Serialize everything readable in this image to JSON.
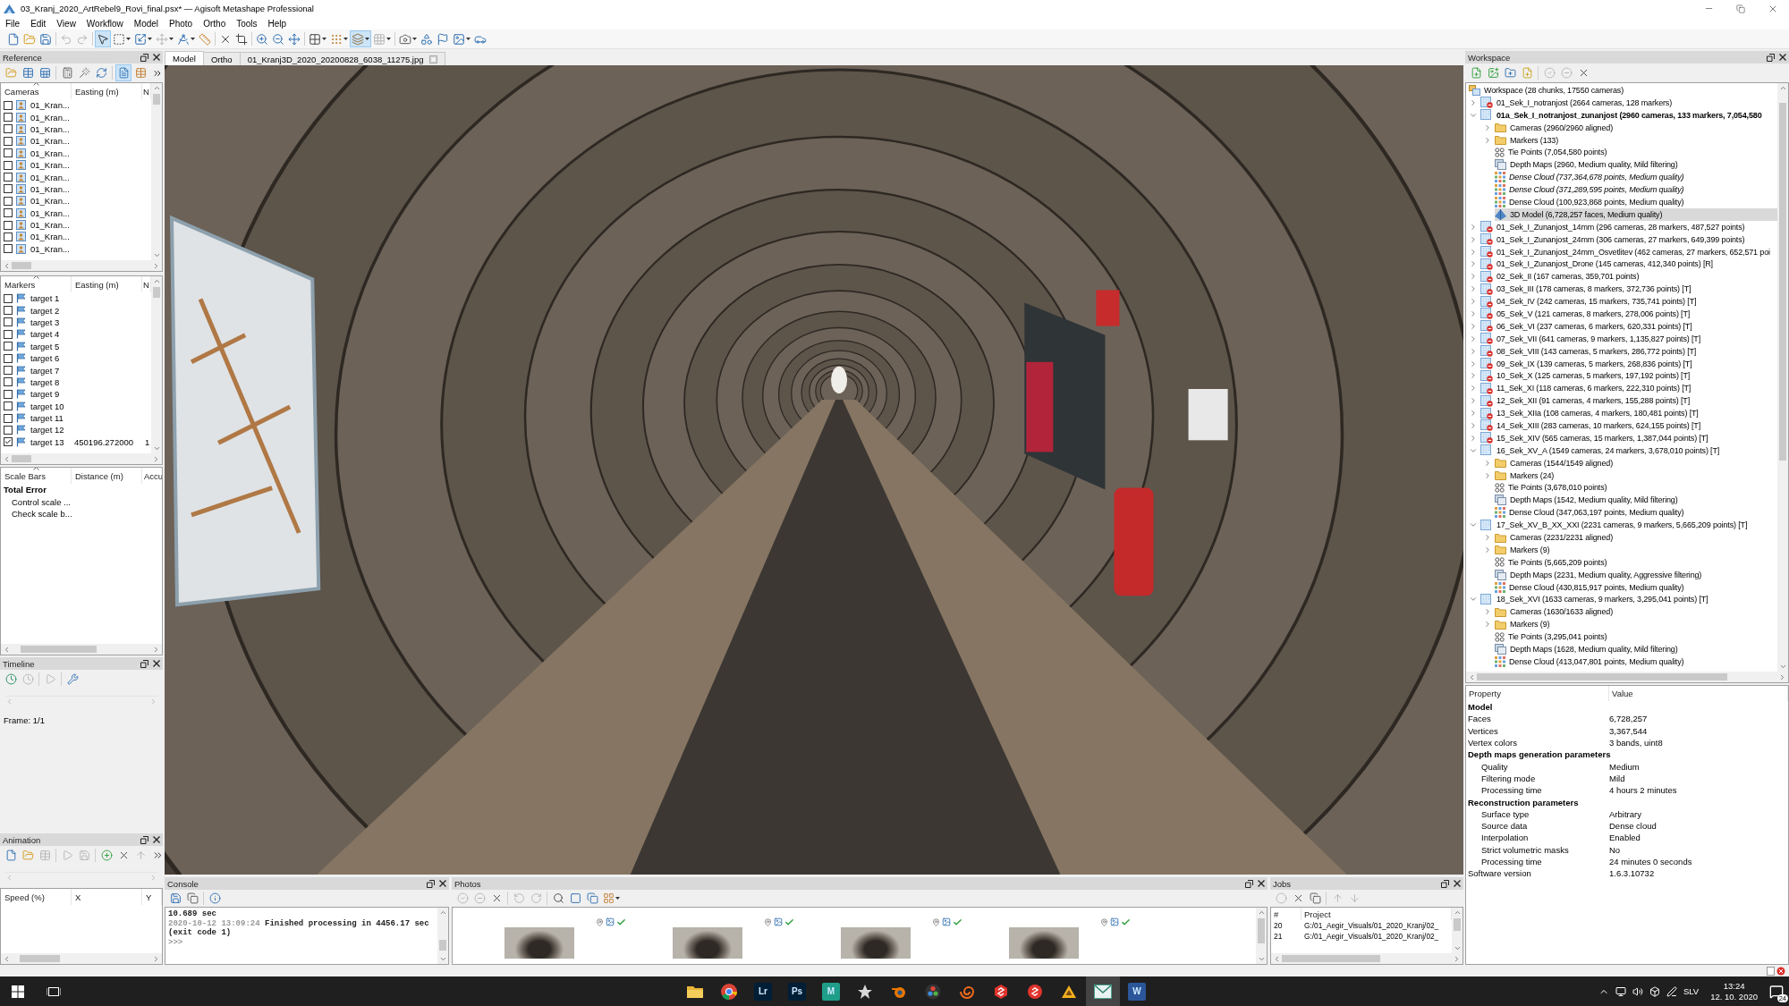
{
  "window": {
    "title": "03_Kranj_2020_ArtRebel9_Rovi_final.psx* — Agisoft Metashape Professional"
  },
  "menu": [
    "File",
    "Edit",
    "View",
    "Workflow",
    "Model",
    "Photo",
    "Ortho",
    "Tools",
    "Help"
  ],
  "toolbar": [
    {
      "pressed": false,
      "disabled": false
    },
    {
      "pressed": false,
      "disabled": false
    },
    {
      "pressed": false,
      "disabled": false
    },
    {
      "pressed": false,
      "disabled": true
    },
    {
      "pressed": false,
      "disabled": true
    },
    {
      "pressed": true,
      "disabled": false
    },
    {
      "pressed": false,
      "disabled": false
    },
    {
      "pressed": false,
      "disabled": false
    },
    {
      "pressed": false,
      "disabled": true
    },
    {
      "pressed": false,
      "disabled": false
    },
    {
      "pressed": false,
      "disabled": false
    },
    {
      "pressed": false,
      "disabled": false
    },
    {
      "pressed": false,
      "disabled": false
    },
    {
      "pressed": false,
      "disabled": false
    },
    {
      "pressed": false,
      "disabled": false
    },
    {
      "pressed": false,
      "disabled": false
    },
    {
      "pressed": false,
      "disabled": false
    },
    {
      "pressed": false,
      "disabled": false
    },
    {
      "pressed": true,
      "disabled": false
    },
    {
      "pressed": false,
      "disabled": true
    },
    {
      "pressed": false,
      "disabled": false
    },
    {
      "pressed": false,
      "disabled": false
    },
    {
      "pressed": false,
      "disabled": false
    },
    {
      "pressed": false,
      "disabled": false
    },
    {
      "pressed": false,
      "disabled": false
    }
  ],
  "reference": {
    "title": "Reference",
    "toolbar": [
      {
        "pressed": false
      },
      {
        "pressed": false
      },
      {
        "pressed": false
      },
      {
        "pressed": false
      },
      {
        "pressed": false
      },
      {
        "pressed": false
      },
      {
        "pressed": true
      },
      {
        "pressed": false
      }
    ],
    "cameras": {
      "columns": [
        "Cameras",
        "Easting (m)",
        "N"
      ],
      "rows": [
        {
          "label": "01_Kran...",
          "checked": false
        },
        {
          "label": "01_Kran...",
          "checked": false
        },
        {
          "label": "01_Kran...",
          "checked": false
        },
        {
          "label": "01_Kran...",
          "checked": false
        },
        {
          "label": "01_Kran...",
          "checked": false
        },
        {
          "label": "01_Kran...",
          "checked": false
        },
        {
          "label": "01_Kran...",
          "checked": false
        },
        {
          "label": "01_Kran...",
          "checked": false
        },
        {
          "label": "01_Kran...",
          "checked": false
        },
        {
          "label": "01_Kran...",
          "checked": false
        },
        {
          "label": "01_Kran...",
          "checked": false
        },
        {
          "label": "01_Kran...",
          "checked": false
        },
        {
          "label": "01_Kran...",
          "checked": false
        }
      ]
    },
    "markers": {
      "columns": [
        "Markers",
        "Easting (m)",
        "N"
      ],
      "rows": [
        {
          "label": "target 1",
          "checked": false
        },
        {
          "label": "target 2",
          "checked": false
        },
        {
          "label": "target 3",
          "checked": false
        },
        {
          "label": "target 4",
          "checked": false
        },
        {
          "label": "target 5",
          "checked": false
        },
        {
          "label": "target 6",
          "checked": false
        },
        {
          "label": "target 7",
          "checked": false
        },
        {
          "label": "target 8",
          "checked": false
        },
        {
          "label": "target 9",
          "checked": false
        },
        {
          "label": "target 10",
          "checked": false
        },
        {
          "label": "target 11",
          "checked": false
        },
        {
          "label": "target 12",
          "checked": false
        },
        {
          "label": "target 13",
          "checked": true,
          "easting": "450196.272000",
          "column_3": "1"
        }
      ]
    },
    "scale_bars": {
      "columns": [
        "Scale Bars",
        "Distance (m)",
        "Accu"
      ],
      "rows": [
        {
          "kind": "total",
          "label": "Total Error"
        },
        {
          "kind": "group",
          "label": "Control scale ..."
        },
        {
          "kind": "group",
          "label": "Check scale b..."
        }
      ]
    }
  },
  "timeline": {
    "title": "Timeline",
    "toolbar": [
      {
        "disabled": false
      },
      {
        "disabled": true
      },
      {
        "disabled": true
      },
      {
        "disabled": false
      }
    ],
    "frame": "Frame: 1/1"
  },
  "animation": {
    "title": "Animation",
    "toolbar": [
      {
        "disabled": false
      },
      {
        "disabled": false
      },
      {
        "disabled": true
      },
      {
        "disabled": true
      },
      {
        "disabled": true
      },
      {
        "disabled": false
      },
      {
        "disabled": false
      },
      {
        "disabled": true
      },
      {
        "disabled": false
      }
    ],
    "columns": [
      "Speed (%)",
      "X",
      "Y"
    ]
  },
  "view": {
    "tabs": [
      {
        "label": "Model",
        "selected": true,
        "closable": false
      },
      {
        "label": "Ortho",
        "selected": false,
        "closable": false
      },
      {
        "label": "01_Kranj3D_2020_20200828_6038_11275.jpg",
        "selected": false,
        "closable": true
      }
    ]
  },
  "console": {
    "title": "Console",
    "toolbar": [
      {
        "disabled": false
      },
      {
        "disabled": false
      },
      {
        "disabled": false
      }
    ],
    "lines": [
      {
        "kind": "output",
        "text": "10.689 sec"
      },
      {
        "kind": "log",
        "time": "2020-10-12 13:09:24",
        "text": "Finished processing in 4456.17 sec"
      },
      {
        "kind": "output",
        "text": "(exit code 1)"
      },
      {
        "kind": "prompt",
        "text": ">>>"
      }
    ]
  },
  "photos": {
    "title": "Photos",
    "toolbar": [
      {
        "disabled": true
      },
      {
        "disabled": true
      },
      {
        "disabled": false
      },
      {
        "disabled": true
      },
      {
        "disabled": true
      },
      {
        "disabled": false
      },
      {
        "disabled": false
      },
      {
        "disabled": false
      },
      {
        "disabled": false
      }
    ],
    "items": [
      {
        "aligned": true
      },
      {
        "aligned": true
      },
      {
        "aligned": true
      },
      {
        "aligned": true
      }
    ]
  },
  "jobs": {
    "title": "Jobs",
    "toolbar": [
      {
        "disabled": true
      },
      {
        "disabled": false
      },
      {
        "disabled": false
      },
      {
        "disabled": true
      },
      {
        "disabled": true
      }
    ],
    "columns": [
      "#",
      "Project"
    ],
    "rows": [
      {
        "number": "20",
        "project": "G:/01_Aegir_Visuals/01_2020_Kranj/02_"
      },
      {
        "number": "21",
        "project": "G:/01_Aegir_Visuals/01_2020_Kranj/02_"
      }
    ]
  },
  "workspace": {
    "title": "Workspace",
    "toolbar": [
      {
        "disabled": false
      },
      {
        "disabled": false
      },
      {
        "disabled": false
      },
      {
        "disabled": false
      },
      {
        "disabled": true
      },
      {
        "disabled": true
      },
      {
        "disabled": false
      }
    ],
    "tree": {
      "kind": "workspace",
      "label": "Workspace (28 chunks, 17550 cameras)",
      "selected": false,
      "children": [
        {
          "kind": "chunk",
          "label": "01_Sek_I_notranjost (2664 cameras, 128 markers)",
          "expanded": false,
          "active": false,
          "badge": true,
          "selected": false
        },
        {
          "kind": "chunk",
          "label": "01a_Sek_I_notranjost_zunanjost (2960 cameras, 133 markers, 7,054,580",
          "expanded": true,
          "active": true,
          "badge": false,
          "selected": false,
          "children": [
            {
              "kind": "cameras",
              "label": "Cameras (2960/2960 aligned)",
              "expanded": false,
              "selected": false
            },
            {
              "kind": "markers",
              "label": "Markers (133)",
              "expanded": false,
              "selected": false
            },
            {
              "kind": "tie_points",
              "label": "Tie Points (7,054,580 points)",
              "selected": false
            },
            {
              "kind": "depth_maps",
              "label": "Depth Maps (2960, Medium quality, Mild filtering)",
              "selected": false
            },
            {
              "kind": "dense_cloud",
              "label": "Dense Cloud (737,364,678 points, Medium quality)",
              "inactive": true,
              "selected": false
            },
            {
              "kind": "dense_cloud",
              "label": "Dense Cloud (371,289,595 points, Medium quality)",
              "inactive": true,
              "selected": false
            },
            {
              "kind": "dense_cloud",
              "label": "Dense Cloud (100,923,868 points, Medium quality)",
              "inactive": false,
              "selected": false
            },
            {
              "kind": "model",
              "label": "3D Model (6,728,257 faces, Medium quality)",
              "selected": true
            }
          ]
        },
        {
          "kind": "chunk",
          "label": "01_Sek_I_Zunanjost_14mm (296 cameras, 28 markers, 487,527 points)",
          "expanded": false,
          "active": false,
          "badge": true,
          "selected": false
        },
        {
          "kind": "chunk",
          "label": "01_Sek_I_Zunanjost_24mm (306 cameras, 27 markers, 649,399 points)",
          "expanded": false,
          "active": false,
          "badge": true,
          "selected": false
        },
        {
          "kind": "chunk",
          "label": "01_Sek_I_Zunanjost_24mm_Osvetlitev (462 cameras, 27 markers, 652,571 poi",
          "expanded": false,
          "active": false,
          "badge": true,
          "selected": false
        },
        {
          "kind": "chunk",
          "label": "01_Sek_I_Zunanjost_Drone (145 cameras, 412,340 points) [R]",
          "expanded": false,
          "active": false,
          "badge": true,
          "selected": false
        },
        {
          "kind": "chunk",
          "label": "02_Sek_II (167 cameras, 359,701 points)",
          "expanded": false,
          "active": false,
          "badge": true,
          "selected": false
        },
        {
          "kind": "chunk",
          "label": "03_Sek_III (178 cameras, 8 markers, 372,736 points) [T]",
          "expanded": false,
          "active": false,
          "badge": true,
          "selected": false
        },
        {
          "kind": "chunk",
          "label": "04_Sek_IV (242 cameras, 15 markers, 735,741 points) [T]",
          "expanded": false,
          "active": false,
          "badge": true,
          "selected": false
        },
        {
          "kind": "chunk",
          "label": "05_Sek_V (121 cameras, 8 markers, 278,006 points) [T]",
          "expanded": false,
          "active": false,
          "badge": true,
          "selected": false
        },
        {
          "kind": "chunk",
          "label": "06_Sek_VI (237 cameras, 6 markers, 620,331 points) [T]",
          "expanded": false,
          "active": false,
          "badge": true,
          "selected": false
        },
        {
          "kind": "chunk",
          "label": "07_Sek_VII (641 cameras, 9 markers, 1,135,827 points) [T]",
          "expanded": false,
          "active": false,
          "badge": true,
          "selected": false
        },
        {
          "kind": "chunk",
          "label": "08_Sek_VIII (143 cameras, 5 markers, 286,772 points) [T]",
          "expanded": false,
          "active": false,
          "badge": true,
          "selected": false
        },
        {
          "kind": "chunk",
          "label": "09_Sek_IX (139 cameras, 5 markers, 268,836 points) [T]",
          "expanded": false,
          "active": false,
          "badge": true,
          "selected": false
        },
        {
          "kind": "chunk",
          "label": "10_Sek_X (125 cameras, 5 markers, 197,192 points) [T]",
          "expanded": false,
          "active": false,
          "badge": true,
          "selected": false
        },
        {
          "kind": "chunk",
          "label": "11_Sek_XI (118 cameras, 6 markers, 222,310 points) [T]",
          "expanded": false,
          "active": false,
          "badge": true,
          "selected": false
        },
        {
          "kind": "chunk",
          "label": "12_Sek_XII (91 cameras, 4 markers, 155,288 points) [T]",
          "expanded": false,
          "active": false,
          "badge": true,
          "selected": false
        },
        {
          "kind": "chunk",
          "label": "13_Sek_XIIa (108 cameras, 4 markers, 180,481 points) [T]",
          "expanded": false,
          "active": false,
          "badge": true,
          "selected": false
        },
        {
          "kind": "chunk",
          "label": "14_Sek_XIII (283 cameras, 10 markers, 624,155 points) [T]",
          "expanded": false,
          "active": false,
          "badge": true,
          "selected": false
        },
        {
          "kind": "chunk",
          "label": "15_Sek_XIV (565 cameras, 15 markers, 1,387,044 points) [T]",
          "expanded": false,
          "active": false,
          "badge": true,
          "selected": false
        },
        {
          "kind": "chunk",
          "label": "16_Sek_XV_A (1549 cameras, 24 markers, 3,678,010 points) [T]",
          "expanded": true,
          "active": false,
          "badge": false,
          "selected": false,
          "children": [
            {
              "kind": "cameras",
              "label": "Cameras (1544/1549 aligned)",
              "expanded": false,
              "selected": false
            },
            {
              "kind": "markers",
              "label": "Markers (24)",
              "expanded": false,
              "selected": false
            },
            {
              "kind": "tie_points",
              "label": "Tie Points (3,678,010 points)",
              "selected": false
            },
            {
              "kind": "depth_maps",
              "label": "Depth Maps (1542, Medium quality, Mild filtering)",
              "selected": false
            },
            {
              "kind": "dense_cloud",
              "label": "Dense Cloud (347,063,197 points, Medium quality)",
              "inactive": false,
              "selected": false
            }
          ]
        },
        {
          "kind": "chunk",
          "label": "17_Sek_XV_B_XX_XXI (2231 cameras, 9 markers, 5,665,209 points) [T]",
          "expanded": true,
          "active": false,
          "badge": false,
          "selected": false,
          "children": [
            {
              "kind": "cameras",
              "label": "Cameras (2231/2231 aligned)",
              "expanded": false,
              "selected": false
            },
            {
              "kind": "markers",
              "label": "Markers (9)",
              "expanded": false,
              "selected": false
            },
            {
              "kind": "tie_points",
              "label": "Tie Points (5,665,209 points)",
              "selected": false
            },
            {
              "kind": "depth_maps",
              "label": "Depth Maps (2231, Medium quality, Aggressive filtering)",
              "selected": false
            },
            {
              "kind": "dense_cloud",
              "label": "Dense Cloud (430,815,917 points, Medium quality)",
              "inactive": false,
              "selected": false
            }
          ]
        },
        {
          "kind": "chunk",
          "label": "18_Sek_XVI (1633 cameras, 9 markers, 3,295,041 points) [T]",
          "expanded": true,
          "active": false,
          "badge": false,
          "selected": false,
          "children": [
            {
              "kind": "cameras",
              "label": "Cameras (1630/1633 aligned)",
              "expanded": false,
              "selected": false
            },
            {
              "kind": "markers",
              "label": "Markers (9)",
              "expanded": false,
              "selected": false
            },
            {
              "kind": "tie_points",
              "label": "Tie Points (3,295,041 points)",
              "selected": false
            },
            {
              "kind": "depth_maps",
              "label": "Depth Maps (1628, Medium quality, Mild filtering)",
              "selected": false
            },
            {
              "kind": "dense_cloud",
              "label": "Dense Cloud (413,047,801 points, Medium quality)",
              "inactive": false,
              "selected": false
            }
          ]
        }
      ]
    }
  },
  "properties": {
    "columns": [
      "Property",
      "Value"
    ],
    "rows": [
      {
        "kind": "heading",
        "label": "Model"
      },
      {
        "kind": "item",
        "label": "Faces",
        "value": "6,728,257"
      },
      {
        "kind": "item",
        "label": "Vertices",
        "value": "3,367,544"
      },
      {
        "kind": "item",
        "label": "Vertex colors",
        "value": "3 bands, uint8"
      },
      {
        "kind": "heading",
        "label": "Depth maps generation parameters",
        "children": [
          {
            "kind": "item",
            "label": "Quality",
            "value": "Medium"
          },
          {
            "kind": "item",
            "label": "Filtering mode",
            "value": "Mild"
          },
          {
            "kind": "item",
            "label": "Processing time",
            "value": "4 hours 2 minutes"
          }
        ]
      },
      {
        "kind": "heading",
        "label": "Reconstruction parameters",
        "children": [
          {
            "kind": "item",
            "label": "Surface type",
            "value": "Arbitrary"
          },
          {
            "kind": "item",
            "label": "Source data",
            "value": "Dense cloud"
          },
          {
            "kind": "item",
            "label": "Interpolation",
            "value": "Enabled"
          },
          {
            "kind": "item",
            "label": "Strict volumetric masks",
            "value": "No"
          },
          {
            "kind": "item",
            "label": "Processing time",
            "value": "24 minutes 0 seconds"
          }
        ]
      },
      {
        "kind": "item",
        "label": "Software version",
        "value": "1.6.3.10732"
      }
    ]
  },
  "taskbar": {
    "apps": [
      {
        "kind": "icon",
        "active": false
      },
      {
        "kind": "icon",
        "active": false
      },
      {
        "kind": "letter",
        "label": "Lr",
        "color": "#001e36",
        "active": false
      },
      {
        "kind": "letter",
        "label": "Ps",
        "color": "#001e36",
        "active": false
      },
      {
        "kind": "letter",
        "label": "M",
        "color": "#1f9e8a",
        "active": false
      },
      {
        "kind": "icon",
        "active": false
      },
      {
        "kind": "icon",
        "active": false
      },
      {
        "kind": "icon",
        "active": false
      },
      {
        "kind": "icon",
        "active": false
      },
      {
        "kind": "icon",
        "active": false
      },
      {
        "kind": "icon",
        "active": false
      },
      {
        "kind": "icon",
        "active": false
      },
      {
        "kind": "icon",
        "active": true
      },
      {
        "kind": "letter",
        "label": "W",
        "color": "#2b579a",
        "active": false
      }
    ],
    "language": "SLV",
    "time": "13:24",
    "date": "12. 10. 2020",
    "notifications": "24"
  }
}
